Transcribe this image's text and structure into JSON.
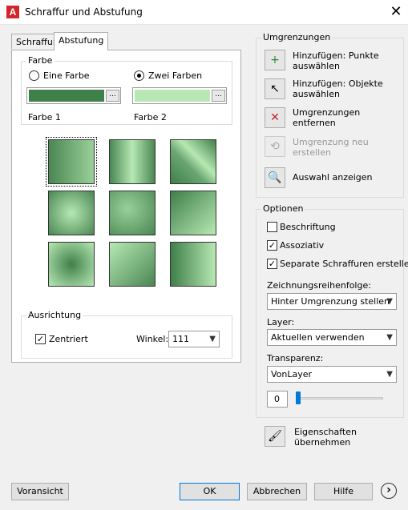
{
  "window": {
    "title": "Schraffur und Abstufung",
    "app_icon": "A"
  },
  "tabs": [
    {
      "label": "Schraffur"
    },
    {
      "label": "Abstufung"
    }
  ],
  "farbe": {
    "label": "Farbe",
    "one_color_label": "Eine Farbe",
    "two_colors_label": "Zwei Farben",
    "color1_label": "Farbe 1",
    "color2_label": "Farbe 2",
    "color1_hex": "#3f7f49",
    "color2_hex": "#b7e8b3",
    "browse_label": "..."
  },
  "ausrichtung": {
    "label": "Ausrichtung",
    "centered_label": "Zentriert",
    "centered_checked": "✓",
    "angle_label": "Winkel:",
    "angle_value": "111"
  },
  "umgrenzungen": {
    "label": "Umgrenzungen",
    "items": [
      {
        "label_line1": "Hinzufügen: Punkte",
        "label_line2": "auswählen",
        "icon": "+"
      },
      {
        "label_line1": "Hinzufügen: Objekte",
        "label_line2": "auswählen",
        "icon": "↖"
      },
      {
        "label_line1": "Umgrenzungen",
        "label_line2": "entfernen",
        "icon": "✕"
      },
      {
        "label_line1": "Umgrenzung neu",
        "label_line2": "erstellen",
        "icon": "⟲"
      },
      {
        "label_line1": "Auswahl anzeigen",
        "label_line2": "",
        "icon": "🔍"
      }
    ]
  },
  "optionen": {
    "label": "Optionen",
    "beschriftung": "Beschriftung",
    "assoziativ": "Assoziativ",
    "separate": "Separate Schraffuren erstellen",
    "check_mark": "✓",
    "draw_order_label": "Zeichnungsreihenfolge:",
    "draw_order_value": "Hinter Umgrenzung stellen",
    "layer_label": "Layer:",
    "layer_value": "Aktuellen verwenden",
    "transparency_label": "Transparenz:",
    "transparency_value": "VonLayer",
    "transparency_number": "0"
  },
  "inherit": {
    "line1": "Eigenschaften",
    "line2": "übernehmen"
  },
  "buttons": {
    "preview": "Voransicht",
    "ok": "OK",
    "cancel": "Abbrechen",
    "help": "Hilfe",
    "more": "›"
  }
}
